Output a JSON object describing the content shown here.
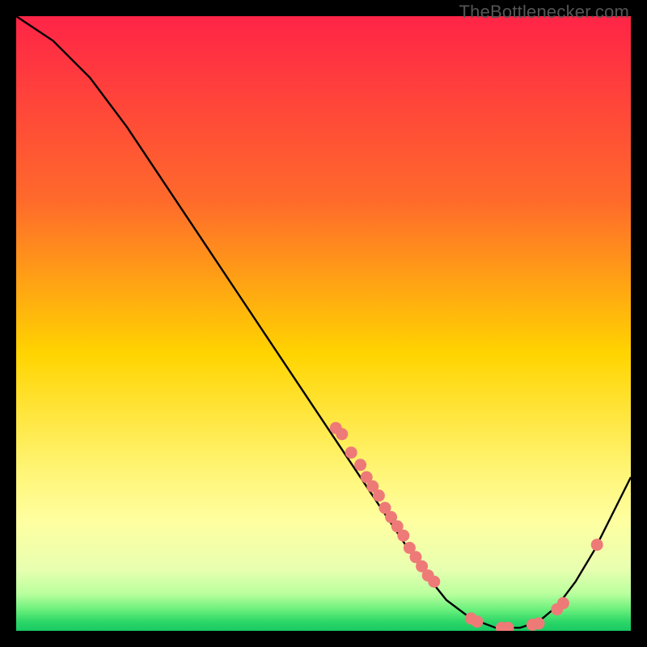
{
  "watermark": "TheBottlenecker.com",
  "chart_data": {
    "type": "line",
    "title": "",
    "xlabel": "",
    "ylabel": "",
    "xlim": [
      0,
      100
    ],
    "ylim": [
      0,
      100
    ],
    "gradient_stops": [
      {
        "offset": 0,
        "color": "#ff2447"
      },
      {
        "offset": 0.3,
        "color": "#ff6a2b"
      },
      {
        "offset": 0.55,
        "color": "#ffd400"
      },
      {
        "offset": 0.72,
        "color": "#fff26a"
      },
      {
        "offset": 0.82,
        "color": "#ffffa0"
      },
      {
        "offset": 0.9,
        "color": "#e8ffb0"
      },
      {
        "offset": 0.94,
        "color": "#b9ff9e"
      },
      {
        "offset": 0.965,
        "color": "#6cf07c"
      },
      {
        "offset": 0.985,
        "color": "#2dd768"
      },
      {
        "offset": 1.0,
        "color": "#17c963"
      }
    ],
    "curve": [
      {
        "x": 0,
        "y": 100
      },
      {
        "x": 6,
        "y": 96
      },
      {
        "x": 12,
        "y": 90
      },
      {
        "x": 18,
        "y": 82
      },
      {
        "x": 24,
        "y": 73
      },
      {
        "x": 30,
        "y": 64
      },
      {
        "x": 36,
        "y": 55
      },
      {
        "x": 42,
        "y": 46
      },
      {
        "x": 48,
        "y": 37
      },
      {
        "x": 54,
        "y": 28
      },
      {
        "x": 58,
        "y": 22
      },
      {
        "x": 62,
        "y": 16
      },
      {
        "x": 66,
        "y": 10
      },
      {
        "x": 70,
        "y": 5
      },
      {
        "x": 74,
        "y": 2
      },
      {
        "x": 78,
        "y": 0.5
      },
      {
        "x": 82,
        "y": 0.5
      },
      {
        "x": 85,
        "y": 1.5
      },
      {
        "x": 88,
        "y": 4
      },
      {
        "x": 91,
        "y": 8
      },
      {
        "x": 94,
        "y": 13
      },
      {
        "x": 97,
        "y": 19
      },
      {
        "x": 100,
        "y": 25
      }
    ],
    "points": [
      {
        "x": 52,
        "y": 33
      },
      {
        "x": 53,
        "y": 32
      },
      {
        "x": 54.5,
        "y": 29
      },
      {
        "x": 56,
        "y": 27
      },
      {
        "x": 57,
        "y": 25
      },
      {
        "x": 58,
        "y": 23.5
      },
      {
        "x": 59,
        "y": 22
      },
      {
        "x": 60,
        "y": 20
      },
      {
        "x": 61,
        "y": 18.5
      },
      {
        "x": 62,
        "y": 17
      },
      {
        "x": 63,
        "y": 15.5
      },
      {
        "x": 64,
        "y": 13.5
      },
      {
        "x": 65,
        "y": 12
      },
      {
        "x": 66,
        "y": 10.5
      },
      {
        "x": 67,
        "y": 9
      },
      {
        "x": 68,
        "y": 8
      },
      {
        "x": 74,
        "y": 2
      },
      {
        "x": 75,
        "y": 1.5
      },
      {
        "x": 79,
        "y": 0.5
      },
      {
        "x": 80,
        "y": 0.5
      },
      {
        "x": 84,
        "y": 1
      },
      {
        "x": 85,
        "y": 1.2
      },
      {
        "x": 88,
        "y": 3.5
      },
      {
        "x": 89,
        "y": 4.5
      },
      {
        "x": 94.5,
        "y": 14
      }
    ],
    "point_color": "#ee7a78",
    "curve_color": "#000000"
  }
}
